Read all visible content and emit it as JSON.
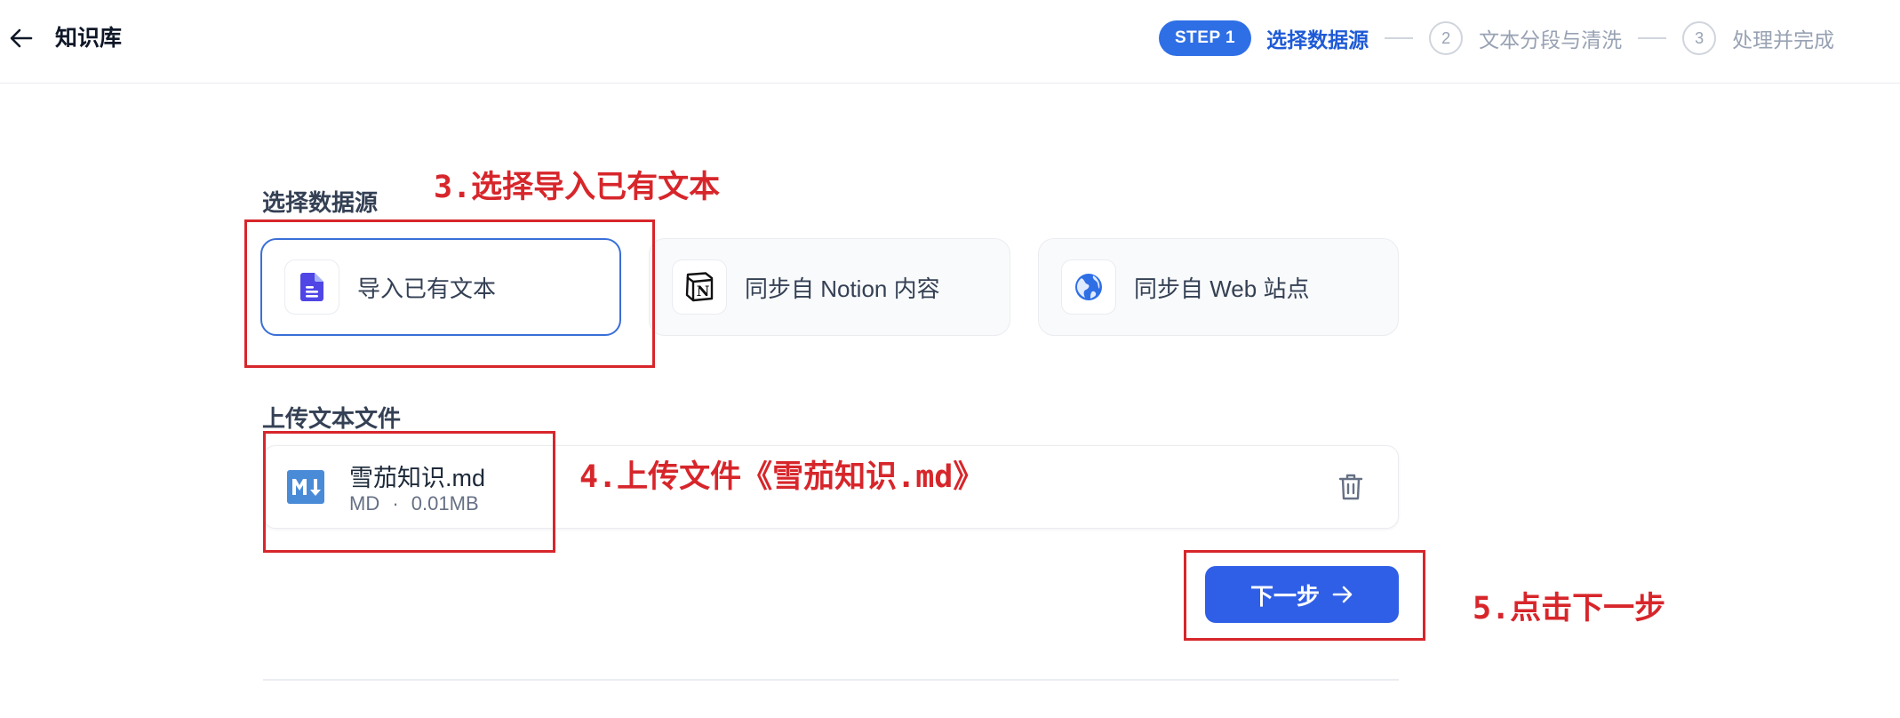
{
  "header": {
    "title": "知识库",
    "back_icon": "arrow-left-icon",
    "steps": [
      {
        "badge": "STEP 1",
        "label": "选择数据源",
        "state": "active"
      },
      {
        "number": "2",
        "label": "文本分段与清洗",
        "state": "pending"
      },
      {
        "number": "3",
        "label": "处理并完成",
        "state": "pending"
      }
    ]
  },
  "data_source": {
    "section_label": "选择数据源",
    "options": [
      {
        "label": "导入已有文本",
        "icon": "document-icon",
        "selected": true
      },
      {
        "label": "同步自 Notion 内容",
        "icon": "notion-icon",
        "selected": false
      },
      {
        "label": "同步自 Web 站点",
        "icon": "globe-icon",
        "selected": false
      }
    ]
  },
  "upload": {
    "section_label": "上传文本文件",
    "file": {
      "name": "雪茄知识.md",
      "type": "MD",
      "separator": "·",
      "size": "0.01MB",
      "icon": "markdown-file-icon"
    },
    "delete_icon": "trash-icon"
  },
  "actions": {
    "next_label": "下一步",
    "next_icon": "arrow-right-icon"
  },
  "annotations": {
    "step3": "3.选择导入已有文本",
    "step4": "4.上传文件《雪茄知识.md》",
    "step5": "5.点击下一步"
  },
  "colors": {
    "primary": "#2f5fe6",
    "annotation_red": "#d7262b",
    "selected_border": "#3a6fd8"
  }
}
